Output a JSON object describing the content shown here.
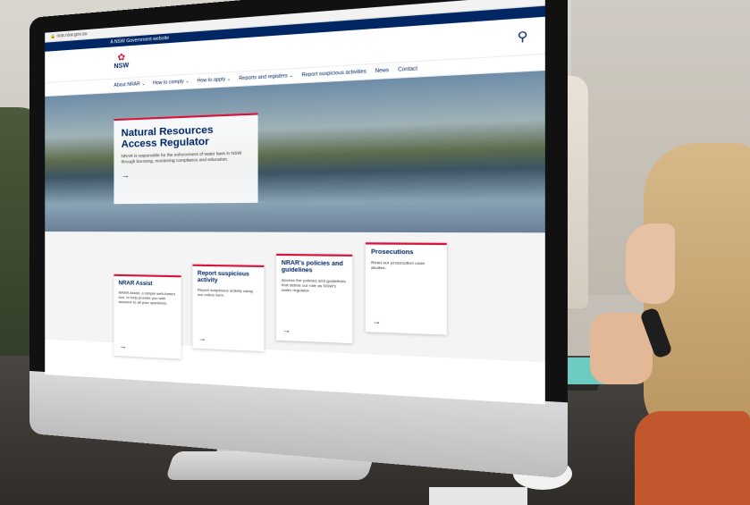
{
  "browser": {
    "url": "nrar.nsw.gov.au"
  },
  "gov_bar": {
    "text": "A NSW Government website"
  },
  "logo": {
    "text": "NSW"
  },
  "nav": {
    "items": [
      "About NRAR ⌄",
      "How to comply ⌄",
      "How to apply ⌄",
      "Reports and registers ⌄",
      "Report suspicious activities",
      "News",
      "Contact"
    ]
  },
  "hero": {
    "title": "Natural Resources Access Regulator",
    "subtitle": "NRAR is responsible for the enforcement of water laws in NSW through licensing, monitoring compliance and education.",
    "arrow": "→"
  },
  "cards": [
    {
      "title": "NRAR Assist",
      "text": "NRAR Assist, a simple web-based tool, to help provide you with answers to all your questions.",
      "arrow": "→"
    },
    {
      "title": "Report suspicious activity",
      "text": "Report suspicious activity using our online form.",
      "arrow": "→"
    },
    {
      "title": "NRAR's policies and guidelines",
      "text": "Access the policies and guidelines that define our role as NSW's water regulator.",
      "arrow": "→"
    },
    {
      "title": "Prosecutions",
      "text": "Read our prosecution case studies.",
      "arrow": "→"
    }
  ],
  "colors": {
    "navy": "#002664",
    "red": "#d7153a"
  },
  "icons": {
    "search": "search-icon",
    "logo": "waratah-icon"
  }
}
